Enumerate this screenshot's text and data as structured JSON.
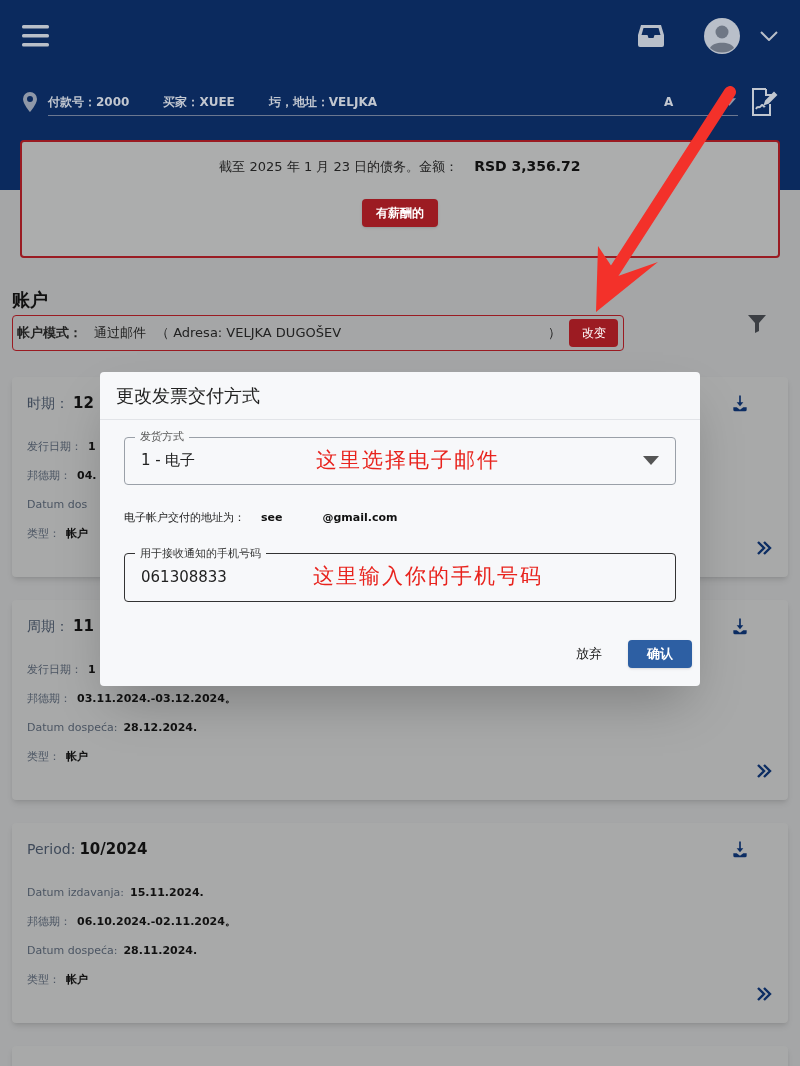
{
  "header": {
    "address_parts": [
      "付款号：2000",
      "买家：XUEE",
      "圬，地址：VELJKA",
      "A"
    ]
  },
  "debt": {
    "text": "截至 2025 年 1 月 23 日的债务。金额：",
    "amount": "RSD 3,356.72",
    "button": "有薪酬的"
  },
  "accounts": {
    "title": "账户",
    "mode_label": "帐户模式：",
    "mode_value": "通过邮件",
    "mode_address": "（ Adresa: VELJKA DUGOŠEV",
    "mode_close": "）",
    "change_button": "改变"
  },
  "cards": [
    {
      "period_label": "时期：",
      "period_value": "12",
      "rows": [
        {
          "label": "发行日期：",
          "value": "1"
        },
        {
          "label": "邦德期：",
          "value": "04."
        },
        {
          "label": "Datum dos",
          "value": ""
        },
        {
          "label": "类型：",
          "value": "帐户"
        }
      ]
    },
    {
      "period_label": "周期：",
      "period_value": "11",
      "rows": [
        {
          "label": "发行日期：",
          "value": "1"
        },
        {
          "label": "邦德期：",
          "value": "03.11.2024.-03.12.2024。"
        },
        {
          "label": "Datum dospeća:",
          "value": "28.12.2024."
        },
        {
          "label": "类型：",
          "value": "帐户"
        }
      ]
    },
    {
      "period_label": "Period:",
      "period_value": "10/2024",
      "rows": [
        {
          "label": "Datum izdavanja:",
          "value": "15.11.2024."
        },
        {
          "label": "邦德期：",
          "value": "06.10.2024.-02.11.2024。"
        },
        {
          "label": "Datum dospeća:",
          "value": "28.11.2024."
        },
        {
          "label": "类型：",
          "value": "帐户"
        }
      ]
    }
  ],
  "dialog": {
    "title": "更改发票交付方式",
    "delivery_label": "发货方式",
    "delivery_value": "1 - 电子",
    "email_label": "电子帐户交付的地址为：",
    "email_parts": [
      "see",
      "@gmail.com"
    ],
    "phone_label": "用于接收通知的手机号码",
    "phone_value": "061308833",
    "cancel": "放弃",
    "confirm": "确认"
  },
  "annotations": {
    "select_note": "这里选择电子邮件",
    "phone_note": "这里输入你的手机号码"
  }
}
